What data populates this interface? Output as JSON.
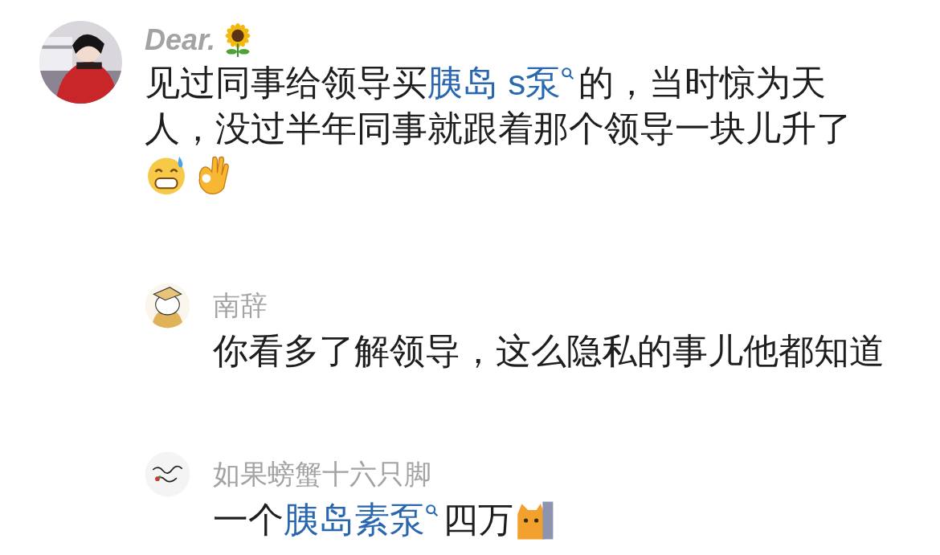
{
  "comment": {
    "author": "Dear.",
    "author_emoji": {
      "kind": "sunflower"
    },
    "lines": [
      [
        {
          "kind": "text",
          "text": "见过同事给领导买"
        },
        {
          "kind": "link",
          "text": "胰岛 s泵"
        },
        {
          "kind": "text",
          "text": "的，当时惊为天"
        }
      ],
      [
        {
          "kind": "text",
          "text": "人，没过半年同事就跟着那个领导一块儿升了"
        }
      ],
      [
        {
          "kind": "grin_sweat"
        },
        {
          "kind": "ok_hand"
        }
      ]
    ]
  },
  "replies": [
    {
      "author": "南辞",
      "lines": [
        [
          {
            "kind": "text",
            "text": "你看多了解领导，这么隐私的事儿他都知道"
          }
        ]
      ]
    },
    {
      "author": "如果螃蟹十六只脚",
      "lines": [
        [
          {
            "kind": "text",
            "text": "一个"
          },
          {
            "kind": "link",
            "text": "胰岛素泵"
          },
          {
            "kind": "text",
            "text": "四万"
          },
          {
            "kind": "cat"
          }
        ]
      ]
    }
  ]
}
